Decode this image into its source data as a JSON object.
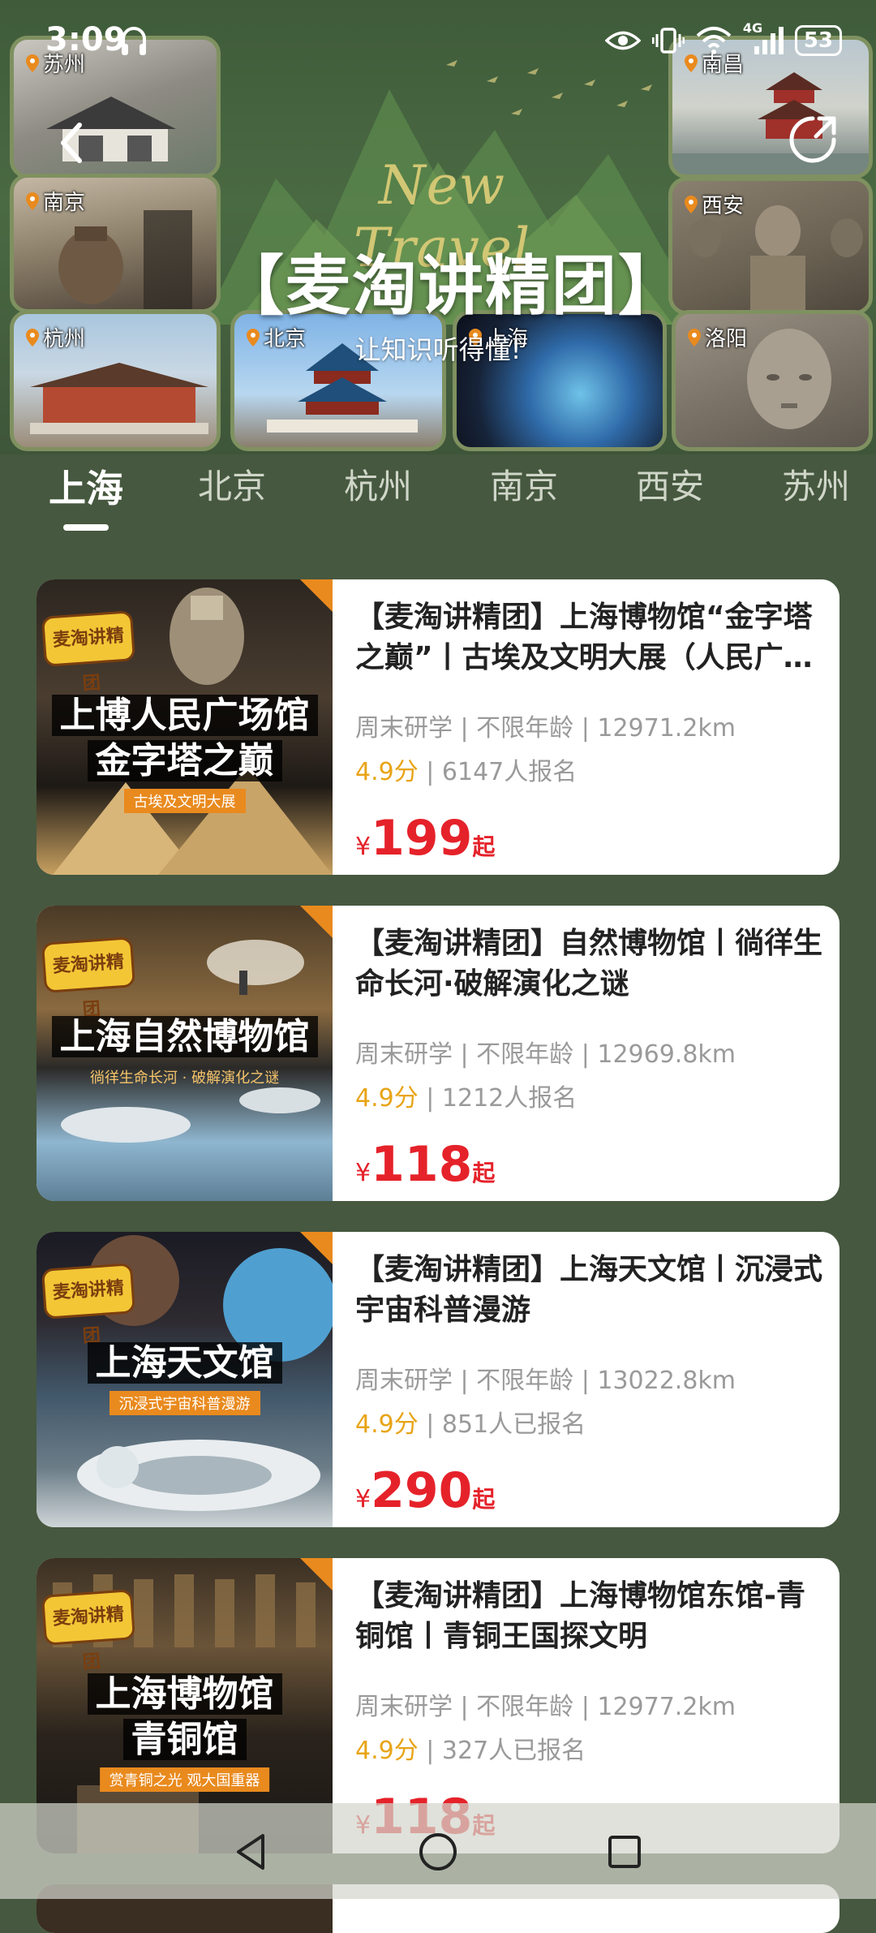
{
  "status_bar": {
    "time": "3:09",
    "network": "4G",
    "battery": "53"
  },
  "hero": {
    "script_title": "New Travel",
    "title": "【麦淘讲精团】",
    "subtitle": "让知识听得懂!",
    "tiles": [
      {
        "city": "苏州"
      },
      {
        "city": "南京"
      },
      {
        "city": "杭州"
      },
      {
        "city": "北京"
      },
      {
        "city": "上海"
      },
      {
        "city": "南昌"
      },
      {
        "city": "西安"
      },
      {
        "city": "洛阳"
      }
    ]
  },
  "tabs": [
    {
      "label": "上海",
      "active": true
    },
    {
      "label": "北京"
    },
    {
      "label": "杭州"
    },
    {
      "label": "南京"
    },
    {
      "label": "西安"
    },
    {
      "label": "苏州"
    }
  ],
  "cards": [
    {
      "thumb_brand": "麦淘讲精团",
      "thumb_line1": "上博人民广场馆",
      "thumb_line2": "金字塔之巅",
      "thumb_tag": "古埃及文明大展",
      "title": "【麦淘讲精团】上海博物馆“金字塔之巅”丨古埃及文明大展（人民广场馆）",
      "meta": "周末研学 | 不限年龄 | 12971.2km",
      "score": "4.9",
      "score_unit": "分",
      "signup": " | 6147人报名",
      "currency": "¥",
      "price": "199",
      "price_suffix": "起"
    },
    {
      "thumb_brand": "麦淘讲精团",
      "thumb_line1": "上海自然博物馆",
      "thumb_line2": "",
      "thumb_tag": "徜徉生命长河 · 破解演化之谜",
      "title": "【麦淘讲精团】自然博物馆丨徜徉生命长河·破解演化之谜",
      "meta": "周末研学 | 不限年龄 | 12969.8km",
      "score": "4.9",
      "score_unit": "分",
      "signup": " | 1212人报名",
      "currency": "¥",
      "price": "118",
      "price_suffix": "起"
    },
    {
      "thumb_brand": "麦淘讲精团",
      "thumb_line1": "上海天文馆",
      "thumb_line2": "",
      "thumb_tag": "沉浸式宇宙科普漫游",
      "title": "【麦淘讲精团】上海天文馆丨沉浸式宇宙科普漫游",
      "meta": "周末研学 | 不限年龄 | 13022.8km",
      "score": "4.9",
      "score_unit": "分",
      "signup": " | 851人已报名",
      "currency": "¥",
      "price": "290",
      "price_suffix": "起"
    },
    {
      "thumb_brand": "麦淘讲精团",
      "thumb_line1": "上海博物馆",
      "thumb_line2": "青铜馆",
      "thumb_tag": "赏青铜之光 观大国重器",
      "title": "【麦淘讲精团】上海博物馆东馆-青铜馆丨青铜王国探文明",
      "meta": "周末研学 | 不限年龄 | 12977.2km",
      "score": "4.9",
      "score_unit": "分",
      "signup": " | 327人已报名",
      "currency": "¥",
      "price": "118",
      "price_suffix": "起"
    }
  ],
  "colors": {
    "page_bg": "#46583f",
    "price": "#e5222a",
    "score": "#e8a417",
    "brand_orange": "#e98a1e"
  },
  "icons": {
    "back": "chevron-left-icon",
    "share": "share-refresh-icon",
    "nav_back": "triangle-back-icon",
    "nav_home": "circle-home-icon",
    "nav_recent": "square-recent-icon"
  }
}
